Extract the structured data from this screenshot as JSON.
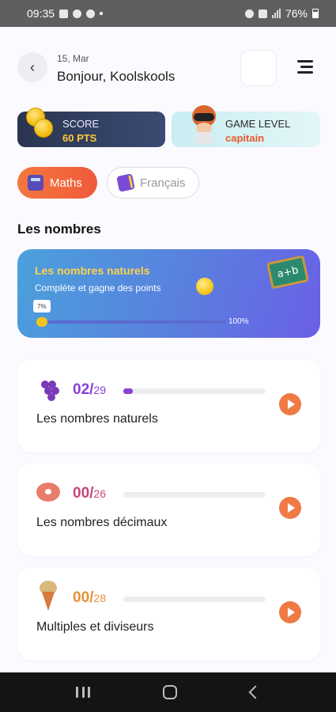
{
  "status_bar": {
    "time": "09:35",
    "battery": "76%"
  },
  "header": {
    "date": "15, Mar",
    "greeting": "Bonjour, Koolskools"
  },
  "score": {
    "label": "SCORE",
    "value": "60 PTS"
  },
  "level": {
    "label": "GAME LEVEL",
    "value": "capitain"
  },
  "tabs": [
    {
      "label": "Maths",
      "active": true
    },
    {
      "label": "Français",
      "active": false
    }
  ],
  "section": {
    "title": "Les nombres"
  },
  "featured": {
    "title": "Les nombres naturels",
    "subtitle": "Complète et gagne des points",
    "board_text": "a+b",
    "progress_label": "7%",
    "progress": 0.07,
    "max_label": "100%"
  },
  "lessons": [
    {
      "done": "02/",
      "total": "29",
      "progress": 0.069,
      "title": "Les nombres naturels",
      "icon": "grapes-icon"
    },
    {
      "done": "00/",
      "total": "26",
      "progress": 0,
      "title": "Les nombres décimaux",
      "icon": "donut-icon"
    },
    {
      "done": "00/",
      "total": "28",
      "progress": 0,
      "title": "Multiples et diviseurs",
      "icon": "ice-cream-icon"
    }
  ],
  "colors": {
    "accent": "#ef5a3a",
    "primary_purple": "#8b3fd6",
    "hero_blue": "#5a7fde"
  }
}
